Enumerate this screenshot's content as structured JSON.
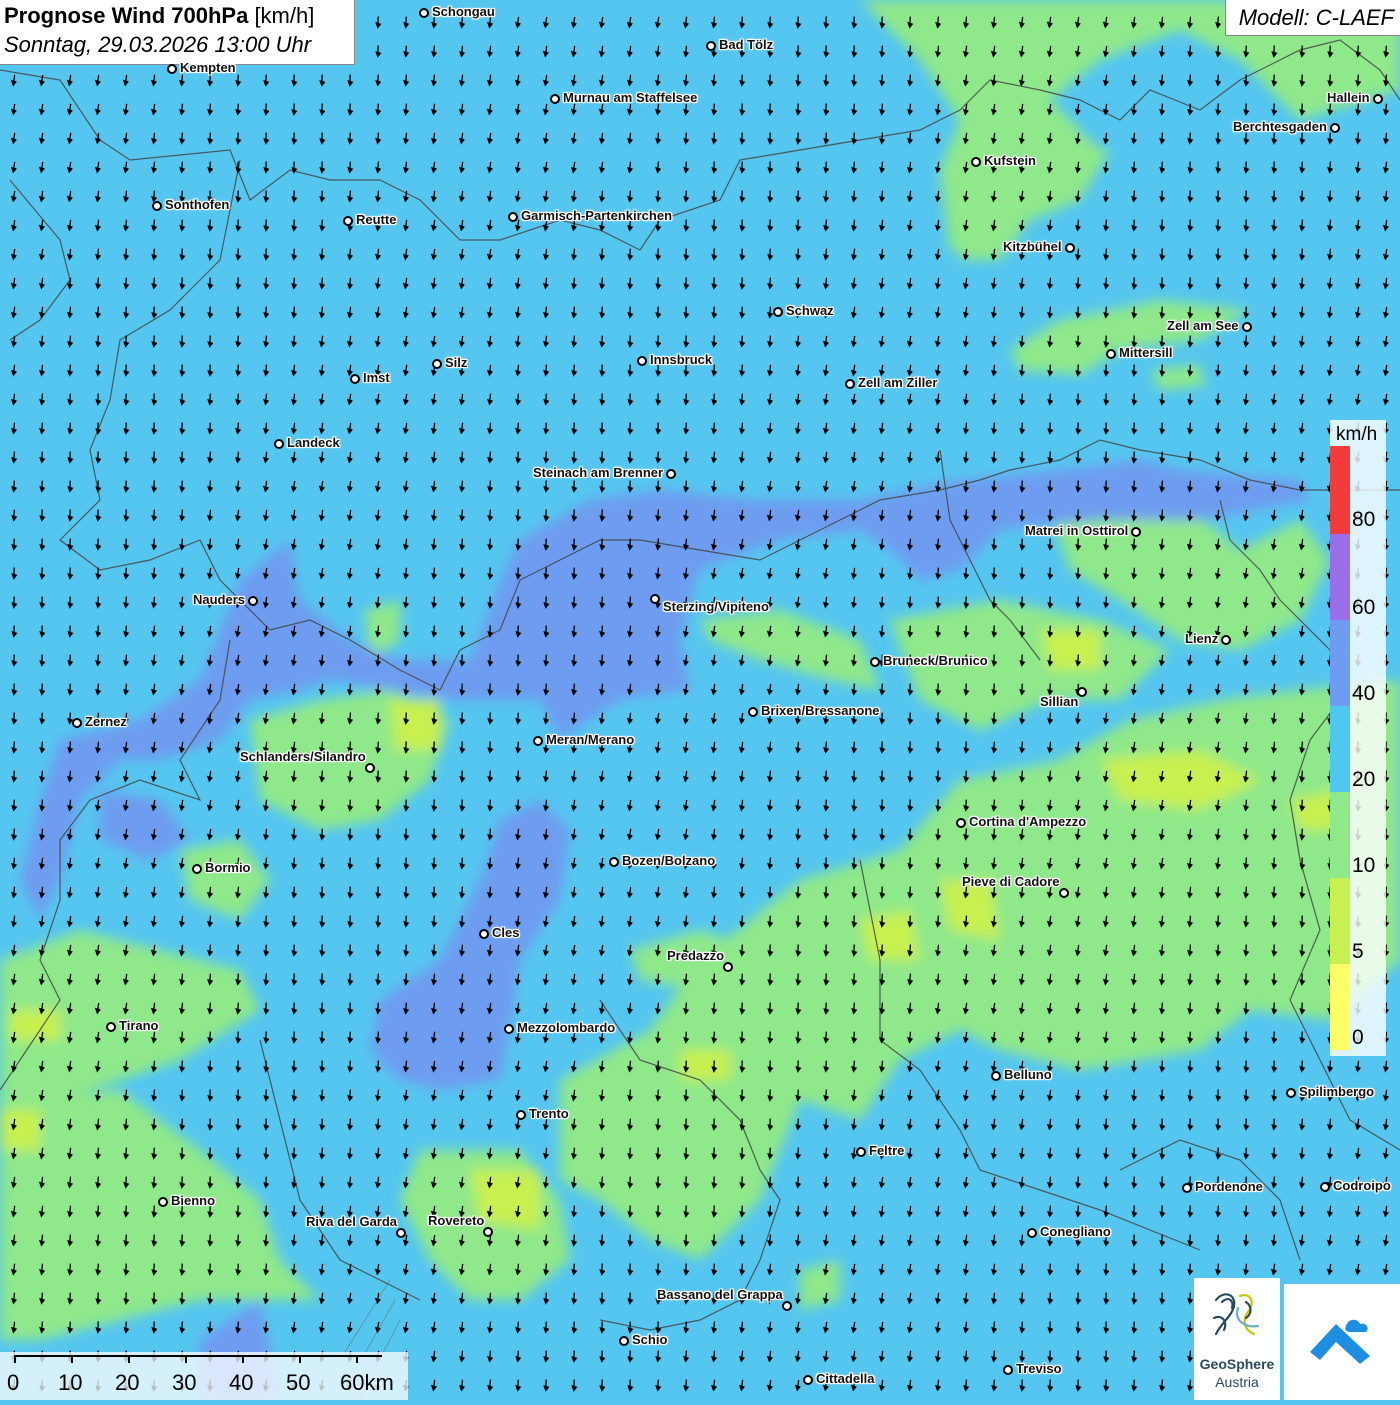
{
  "title": {
    "main_bold": "Prognose Wind 700hPa",
    "unit": "[km/h]",
    "datetime": "Sonntag, 29.03.2026 13:00 Uhr"
  },
  "model_label": "Modell: C-LAEF",
  "legend": {
    "unit": "km/h",
    "ticks": [
      "0",
      "5",
      "10",
      "20",
      "40",
      "60",
      "80"
    ],
    "colors": [
      "#ffff66",
      "#c8f050",
      "#8fe88a",
      "#4fc8f0",
      "#6e9cf0",
      "#9a6ee8",
      "#f23c3c"
    ]
  },
  "scale_bar": {
    "labels": [
      "0",
      "10",
      "20",
      "30",
      "40",
      "50",
      "60km"
    ]
  },
  "logo": {
    "name_line1": "GeoSphere",
    "name_line2": "Austria"
  },
  "cities": [
    {
      "name": "Schongau"
    },
    {
      "name": "Bad Tölz"
    },
    {
      "name": "Kempten"
    },
    {
      "name": "Murnau am Staffelsee"
    },
    {
      "name": "Hallein"
    },
    {
      "name": "Berchtesgaden"
    },
    {
      "name": "Kufstein"
    },
    {
      "name": "Sonthofen"
    },
    {
      "name": "Reutte"
    },
    {
      "name": "Garmisch-Partenkirchen"
    },
    {
      "name": "Kitzbühel"
    },
    {
      "name": "Schwaz"
    },
    {
      "name": "Zell am See"
    },
    {
      "name": "Mittersill"
    },
    {
      "name": "Imst"
    },
    {
      "name": "Silz"
    },
    {
      "name": "Innsbruck"
    },
    {
      "name": "Zell am Ziller"
    },
    {
      "name": "Landeck"
    },
    {
      "name": "Steinach am Brenner"
    },
    {
      "name": "Matrei in Osttirol"
    },
    {
      "name": "Nauders"
    },
    {
      "name": "Sterzing/Vipiteno"
    },
    {
      "name": "Lienz"
    },
    {
      "name": "Bruneck/Brunico"
    },
    {
      "name": "Sillian"
    },
    {
      "name": "Zernez"
    },
    {
      "name": "Brixen/Bressanone"
    },
    {
      "name": "Meran/Merano"
    },
    {
      "name": "Schlanders/Silandro"
    },
    {
      "name": "Cortina d'Ampezzo"
    },
    {
      "name": "Bormio"
    },
    {
      "name": "Bozen/Bolzano"
    },
    {
      "name": "Pieve di Cadore"
    },
    {
      "name": "Cles"
    },
    {
      "name": "Predazzo"
    },
    {
      "name": "Tirano"
    },
    {
      "name": "Mezzolombardo"
    },
    {
      "name": "Belluno"
    },
    {
      "name": "Spilimbergo"
    },
    {
      "name": "Trento"
    },
    {
      "name": "Feltre"
    },
    {
      "name": "Pordenone"
    },
    {
      "name": "Codroipo"
    },
    {
      "name": "Bienno"
    },
    {
      "name": "Riva del Garda"
    },
    {
      "name": "Rovereto"
    },
    {
      "name": "Conegliano"
    },
    {
      "name": "Bassano del Grappa"
    },
    {
      "name": "Schio"
    },
    {
      "name": "Treviso"
    },
    {
      "name": "Cittadella"
    }
  ]
}
